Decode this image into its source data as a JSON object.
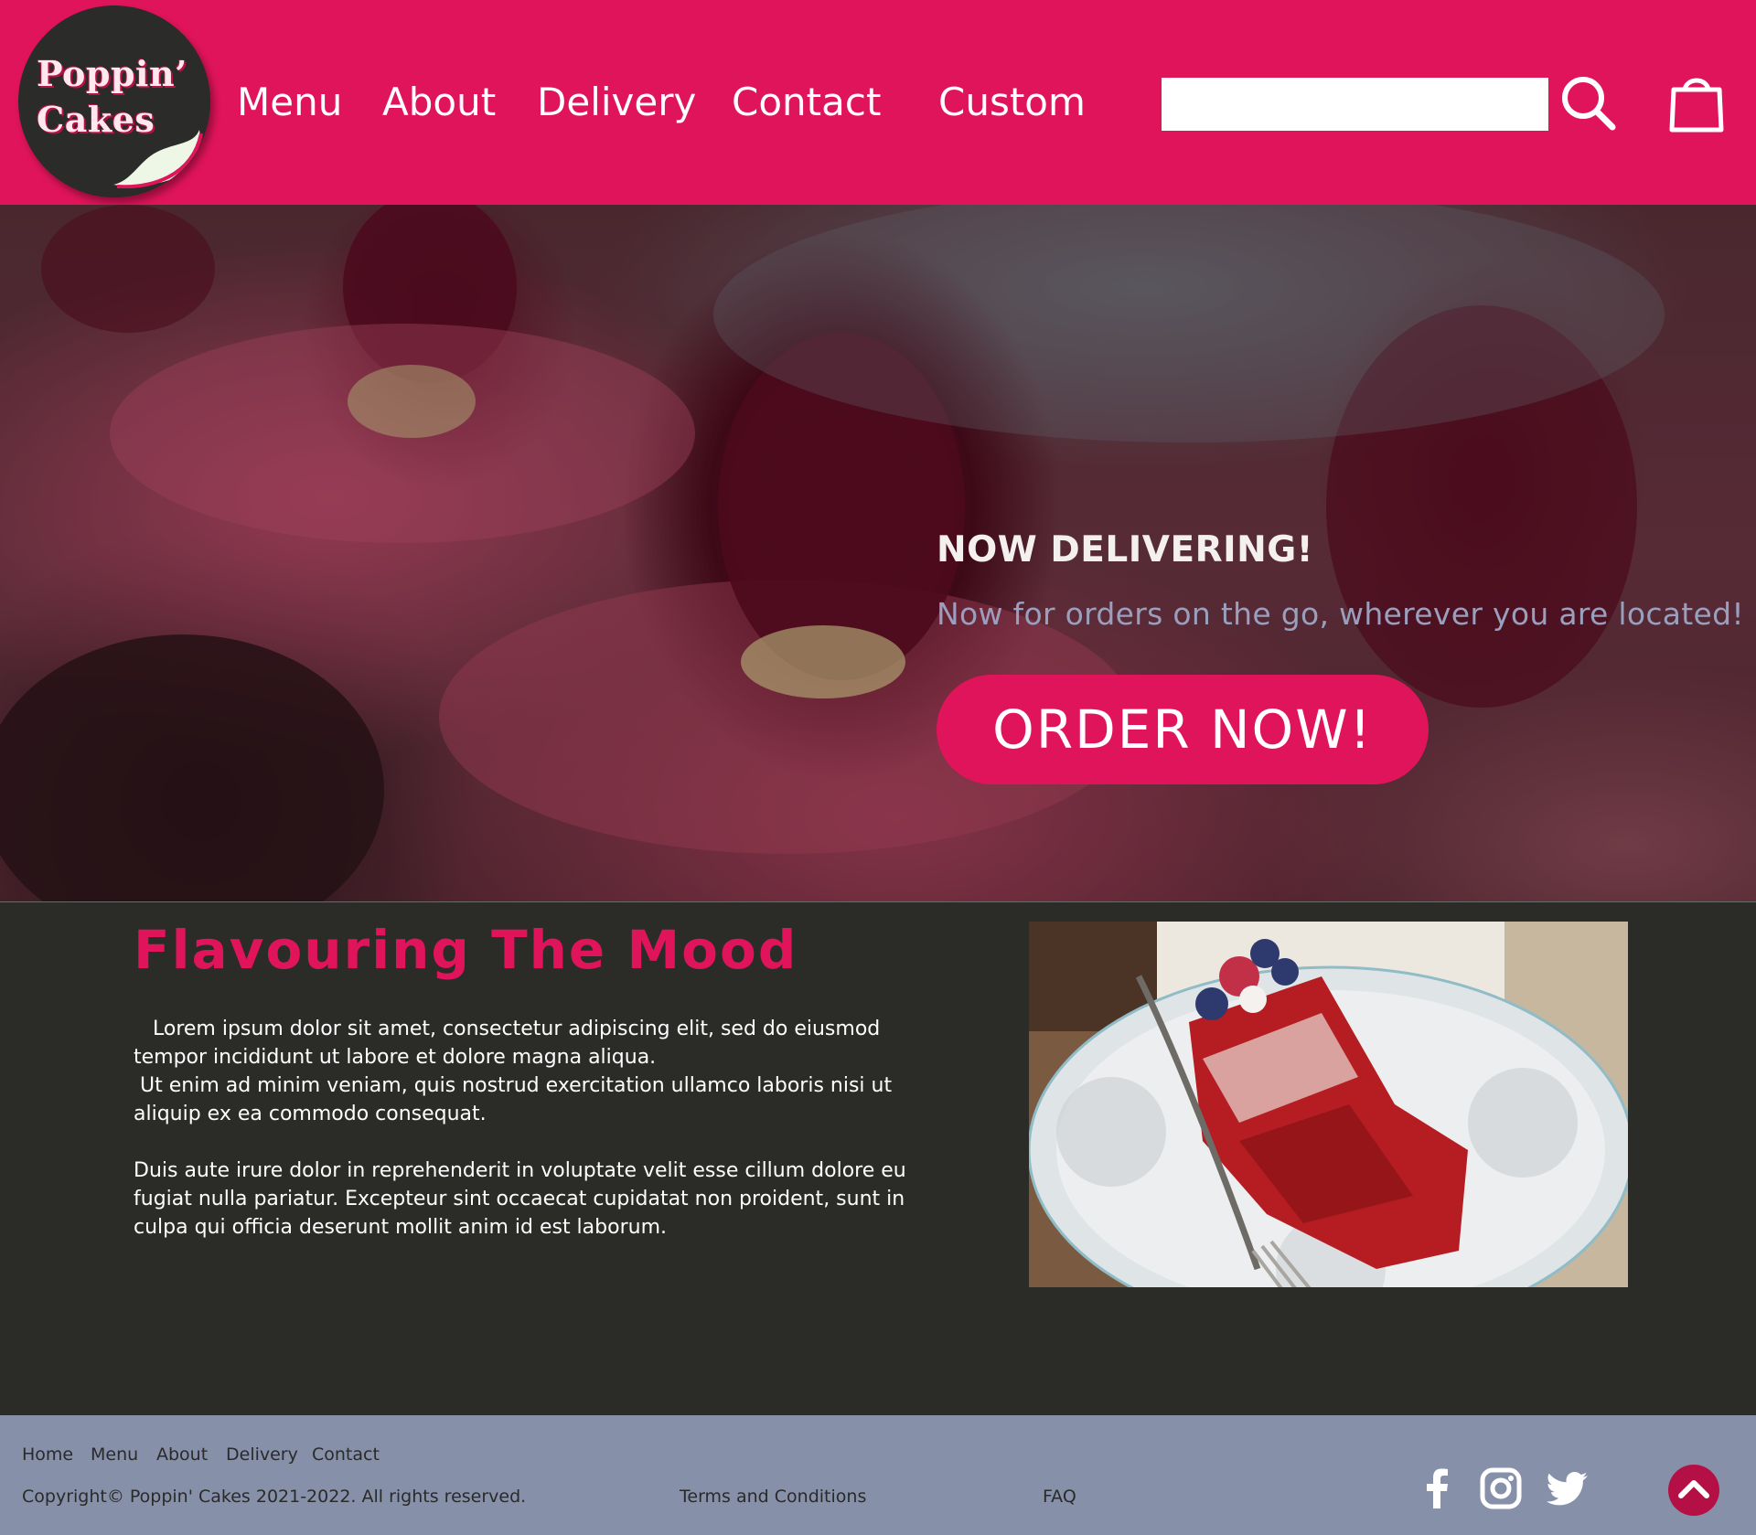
{
  "brand": {
    "logo_line1": "Poppin’",
    "logo_line2": "Cakes",
    "colors": {
      "primary": "#e0145a",
      "dark": "#2b2c28",
      "footer": "#8690a9"
    }
  },
  "nav": {
    "items": [
      {
        "label": "Menu"
      },
      {
        "label": "About"
      },
      {
        "label": "Delivery"
      },
      {
        "label": "Contact"
      },
      {
        "label": "Custom"
      }
    ]
  },
  "search": {
    "value": "",
    "placeholder": "",
    "icon": "search-icon"
  },
  "cart": {
    "icon": "shopping-bag-icon"
  },
  "hero": {
    "title": "NOW DELIVERING!",
    "subtitle": "Now for orders on the go, wherever you are located!",
    "cta_label": "ORDER NOW!"
  },
  "about": {
    "title": "Flavouring The Mood",
    "paragraph1": "   Lorem ipsum dolor sit amet, consectetur adipiscing elit, sed do eiusmod tempor incididunt ut labore et dolore magna aliqua.\n Ut enim ad minim veniam, quis nostrud exercitation ullamco laboris nisi ut aliquip ex ea commodo consequat.",
    "paragraph2": "Duis aute irure dolor in reprehenderit in voluptate velit esse cillum dolore eu fugiat nulla pariatur. Excepteur sint occaecat cupidatat non proident, sunt in culpa qui officia deserunt mollit anim id est laborum."
  },
  "footer": {
    "links": [
      {
        "label": "Home"
      },
      {
        "label": "Menu"
      },
      {
        "label": "About"
      },
      {
        "label": "Delivery"
      },
      {
        "label": "Contact"
      }
    ],
    "copyright": "Copyright© Poppin' Cakes 2021-2022. All rights reserved.",
    "terms": "Terms and Conditions",
    "faq": "FAQ",
    "social": [
      "facebook-icon",
      "instagram-icon",
      "twitter-icon"
    ],
    "back_to_top": "chevron-up-icon"
  }
}
